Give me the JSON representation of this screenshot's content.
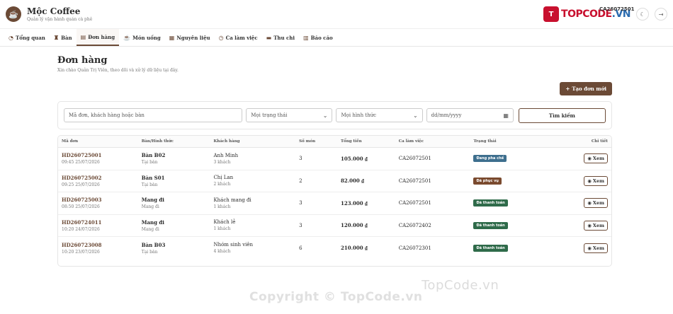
{
  "app": {
    "name": "Mộc Coffee",
    "subtitle": "Quản lý vận hành quán cà phê",
    "shift_code": "CA26072501",
    "brand_logo_text_a": "TOPCODE",
    "brand_logo_text_b": ".VN",
    "brand_mark": "T"
  },
  "nav": [
    {
      "label": "Tổng quan",
      "icon": "dashboard-icon",
      "glyph": "◔"
    },
    {
      "label": "Bàn",
      "icon": "chair-icon",
      "glyph": "♜"
    },
    {
      "label": "Đơn hàng",
      "icon": "receipt-icon",
      "glyph": "▤"
    },
    {
      "label": "Món uống",
      "icon": "mug-icon",
      "glyph": "☕"
    },
    {
      "label": "Nguyên liệu",
      "icon": "boxes-icon",
      "glyph": "▦"
    },
    {
      "label": "Ca làm việc",
      "icon": "clock-icon",
      "glyph": "◷"
    },
    {
      "label": "Thu chi",
      "icon": "wallet-icon",
      "glyph": "▬"
    },
    {
      "label": "Báo cáo",
      "icon": "chart-icon",
      "glyph": "▥"
    }
  ],
  "page": {
    "title": "Đơn hàng",
    "subtitle": "Xin chào Quản Trị Viên, theo dõi và xử lý dữ liệu tại đây.",
    "create_button": "Tạo đơn mới"
  },
  "filters": {
    "search_placeholder": "Mã đơn, khách hàng hoặc bàn",
    "status_value": "Mọi trạng thái",
    "method_value": "Mọi hình thức",
    "date_placeholder": "dd/mm/yyyy",
    "search_button": "Tìm kiếm"
  },
  "table": {
    "headers": [
      "Mã đơn",
      "Bàn/Hình thức",
      "Khách hàng",
      "Số món",
      "Tổng tiền",
      "Ca làm việc",
      "Trạng thái",
      "Chi tiết"
    ],
    "view_label": "Xem",
    "rows": [
      {
        "code": "HD260725001",
        "time": "09:45 25/07/2026",
        "table": "Bàn B02",
        "method": "Tại bàn",
        "customer": "Anh Minh",
        "guests": "3 khách",
        "items": "3",
        "total": "105.000 ₫",
        "shift": "CA26072501",
        "status": "Đang pha chế",
        "status_color": "#3e6f8e"
      },
      {
        "code": "HD260725002",
        "time": "09:25 25/07/2026",
        "table": "Bàn S01",
        "method": "Tại bàn",
        "customer": "Chị Lan",
        "guests": "2 khách",
        "items": "2",
        "total": "82.000 ₫",
        "shift": "CA26072501",
        "status": "Đã phục vụ",
        "status_color": "#7a4a2e"
      },
      {
        "code": "HD260725003",
        "time": "08:50 25/07/2026",
        "table": "Mang đi",
        "method": "Mang đi",
        "customer": "Khách mang đi",
        "guests": "1 khách",
        "items": "3",
        "total": "123.000 ₫",
        "shift": "CA26072501",
        "status": "Đã thanh toán",
        "status_color": "#2f6b4a"
      },
      {
        "code": "HD260724011",
        "time": "10:20 24/07/2026",
        "table": "Mang đi",
        "method": "Mang đi",
        "customer": "Khách lẻ",
        "guests": "1 khách",
        "items": "3",
        "total": "120.000 ₫",
        "shift": "CA26072402",
        "status": "Đã thanh toán",
        "status_color": "#2f6b4a"
      },
      {
        "code": "HD260723008",
        "time": "10:20 23/07/2026",
        "table": "Bàn B03",
        "method": "Tại bàn",
        "customer": "Nhóm sinh viên",
        "guests": "4 khách",
        "items": "6",
        "total": "210.000 ₫",
        "shift": "CA26072301",
        "status": "Đã thanh toán",
        "status_color": "#2f6b4a"
      }
    ]
  },
  "watermarks": {
    "copyright": "Copyright © TopCode.vn",
    "site": "TopCode.vn"
  }
}
